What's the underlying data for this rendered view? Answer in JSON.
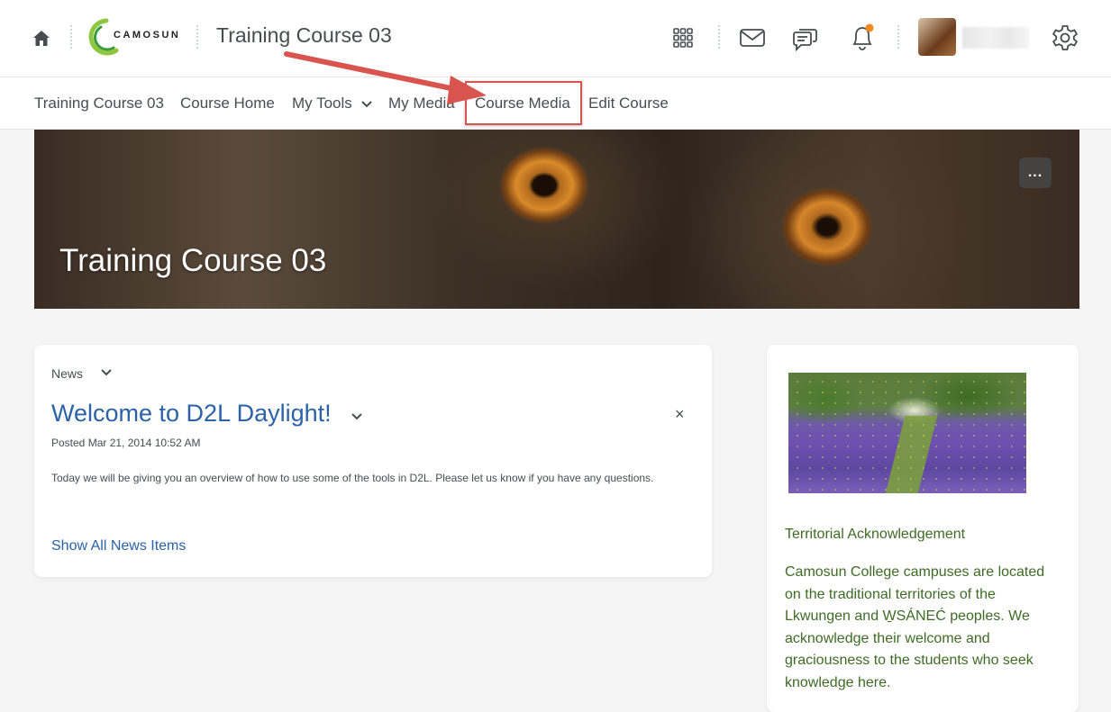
{
  "header": {
    "logo_text": "CAMOSUN",
    "course_title": "Training Course 03"
  },
  "nav": {
    "items": [
      "Training Course 03",
      "Course Home",
      "My Tools",
      "My Media",
      "Course Media",
      "Edit Course"
    ]
  },
  "banner": {
    "title": "Training Course 03",
    "more_label": "..."
  },
  "news": {
    "widget_label": "News",
    "item_title": "Welcome to D2L Daylight!",
    "posted": "Posted Mar 21, 2014 10:52 AM",
    "body": "Today we will be giving you an overview of how to use some of the tools in D2L.  Please let us know if you have any questions.",
    "show_all": "Show All News Items",
    "close_label": "×"
  },
  "acknowledgement": {
    "title": "Territorial Acknowledgement",
    "body": "Camosun College campuses are located on the traditional territories of the Lkwungen and W̱SÁNEĆ peoples. We acknowledge their welcome and graciousness to the students who seek knowledge here."
  },
  "icons": [
    "home-icon",
    "waffle-icon",
    "mail-icon",
    "chat-icon",
    "bell-icon",
    "gear-icon"
  ],
  "colors": {
    "link_blue": "#2b62a8",
    "ack_green": "#3e6b25",
    "highlight_red": "#d9534f",
    "notification_orange": "#f28a1c",
    "logo_green": "#8dc63f"
  }
}
